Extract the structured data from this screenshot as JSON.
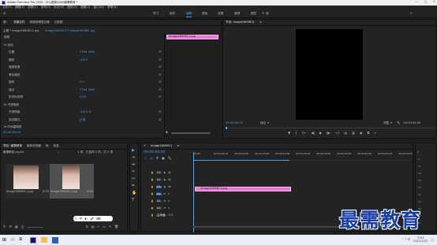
{
  "window": {
    "title": "Adobe Premiere Pro 2020 - D:\\\\视频\\\\06\\\\最需教育 *"
  },
  "menu": [
    "文件(F)",
    "编辑(E)",
    "剪辑(C)",
    "序列(S)",
    "标记(M)",
    "图形(G)",
    "视图(V)",
    "窗口(W)",
    "帮助(H)"
  ],
  "workspaces": [
    "学习",
    "组件",
    "编辑",
    "颜色",
    "效果",
    "音频",
    "图形",
    "库"
  ],
  "effect_controls": {
    "tabs": [
      "源：",
      "效果控件",
      "音频剪辑混合器",
      "元数据"
    ],
    "clip_header": "主要 * lmage1609811.jpg",
    "clip_header2": "Image1609811 * Image16098C.jpg",
    "sections": [
      {
        "label": "视频",
        "kind": "header"
      },
      {
        "label": "fx 运动",
        "kind": "group"
      },
      {
        "label": "位置",
        "value": "3760   1850"
      },
      {
        "label": "缩放",
        "value": "100.0"
      },
      {
        "label": "缩放宽度",
        "value": ""
      },
      {
        "label": "等比缩放",
        "value": ""
      },
      {
        "label": "旋转",
        "value": "0.0"
      },
      {
        "label": "锚点",
        "value": "3760   1850"
      },
      {
        "label": "防闪烁滤镜",
        "value": "0.00"
      },
      {
        "label": "fx 不透明度",
        "kind": "group"
      },
      {
        "label": "不透明度",
        "value": "100.0 %"
      },
      {
        "label": "混合模式",
        "value": "正常"
      },
      {
        "label": "fx 时间重映射",
        "kind": "group"
      }
    ],
    "timeline_clip": "Image1609811.jpg",
    "timecode": "00:00:00:00"
  },
  "program_monitor": {
    "title": "节目: Image1609811",
    "timecode": "00:00:00:00",
    "fit": "适合",
    "quality": "完整",
    "duration": "00:00:05:00"
  },
  "project": {
    "tabs": [
      "项目: 最需教育",
      "媒体浏览器",
      "库",
      "信息"
    ],
    "path": "最需教育.prproj",
    "count": "1 项，已选择 1 项，共 2 项",
    "items": [
      {
        "name": "Image1609811.jpg",
        "duration": "5:00"
      },
      {
        "name": "Image1609812.jpg",
        "duration": "5:00"
      }
    ]
  },
  "timeline": {
    "title": "Image1609811",
    "timecode": "00:00:00:00",
    "ruler": [
      "00:00",
      "00:00:05:00",
      "00:00:10:00",
      "00:00:15:00",
      "00:00:20:00",
      "00:00:25:00",
      "00:00:30:00",
      "00:00:35:00",
      "00:00:40:00",
      "00:00:45:00",
      "00:00:50:00"
    ],
    "tracks": [
      "V3",
      "V2",
      "V1",
      "A1",
      "A2",
      "A3",
      "主声道"
    ],
    "master_value": "0.0",
    "clip": "Image1609811.jpg"
  },
  "watermark": "最需教育",
  "clock": {
    "time": "9:03",
    "date": "2021/1/22"
  }
}
